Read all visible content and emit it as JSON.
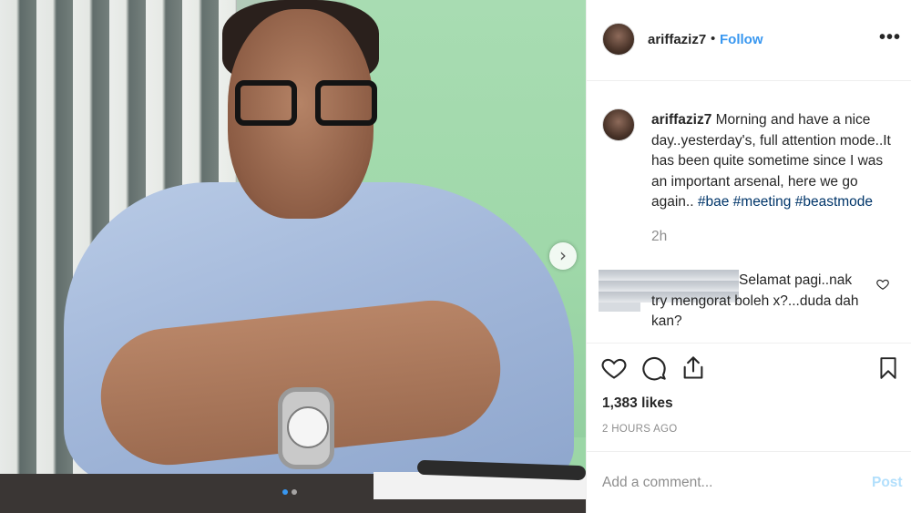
{
  "photo": {
    "next_glyph": "›",
    "carousel": {
      "count": 2,
      "active": 1
    }
  },
  "header": {
    "username": "ariffaziz7",
    "separator": "•",
    "follow_label": "Follow",
    "more_glyph": "•••"
  },
  "caption": {
    "username": "ariffaziz7",
    "text": " Morning and have a nice day..yesterday's, full attention mode..It has been quite sometime since I was an important arsenal, here we go again.. ",
    "hashtags": [
      "#bae",
      "#meeting",
      "#beastmode"
    ],
    "time": "2h"
  },
  "comment": {
    "text": "Selamat pagi..nak try mengorat boleh x?...duda dah kan?"
  },
  "actions": {
    "like_icon": "heart-icon",
    "comment_icon": "comment-bubble-icon",
    "share_icon": "share-upload-icon",
    "save_icon": "bookmark-icon"
  },
  "likes": "1,383 likes",
  "posted_ago": "2 HOURS AGO",
  "add_comment": {
    "placeholder": "Add a comment...",
    "post_label": "Post"
  },
  "colors": {
    "link": "#3897f0",
    "hashtag": "#003569",
    "muted": "#8e8e8e",
    "post_disabled": "#b2dffc"
  }
}
